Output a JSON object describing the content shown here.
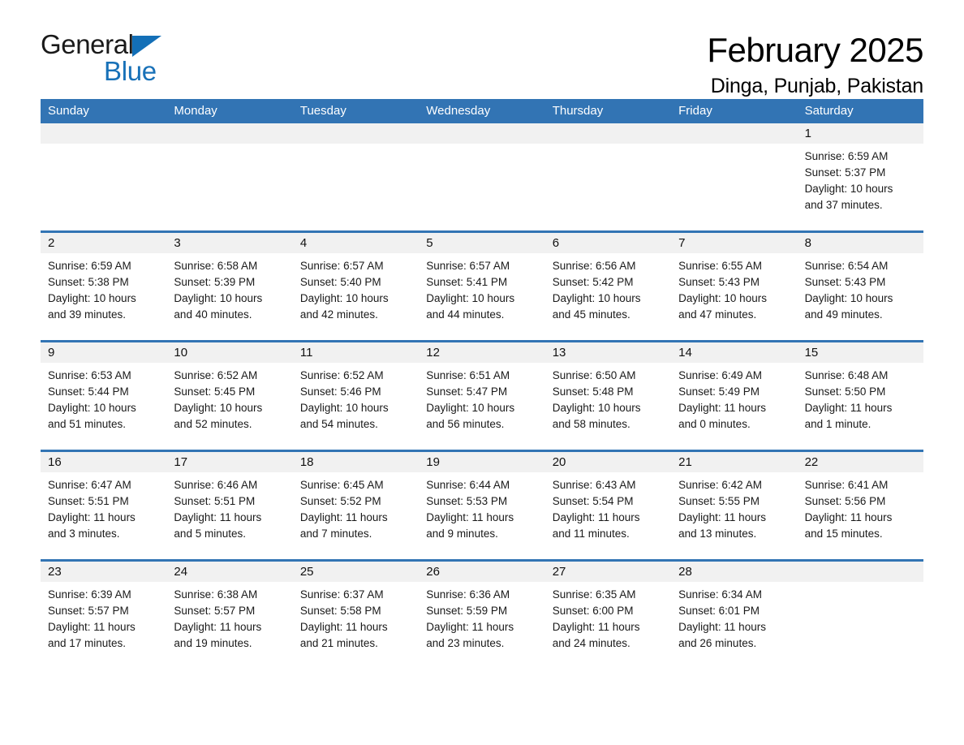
{
  "brand": {
    "name_part1": "General",
    "name_part2": "Blue",
    "accent_color": "#1871b8",
    "triangle_icon": "triangle-icon"
  },
  "header": {
    "month_title": "February 2025",
    "location": "Dinga, Punjab, Pakistan",
    "header_bg_color": "#3274b4",
    "band_bg_color": "#f1f1f1"
  },
  "weekdays": [
    "Sunday",
    "Monday",
    "Tuesday",
    "Wednesday",
    "Thursday",
    "Friday",
    "Saturday"
  ],
  "weeks": [
    [
      {
        "day": "",
        "empty": true
      },
      {
        "day": "",
        "empty": true
      },
      {
        "day": "",
        "empty": true
      },
      {
        "day": "",
        "empty": true
      },
      {
        "day": "",
        "empty": true
      },
      {
        "day": "",
        "empty": true
      },
      {
        "day": "1",
        "sunrise": "Sunrise: 6:59 AM",
        "sunset": "Sunset: 5:37 PM",
        "daylight_line1": "Daylight: 10 hours",
        "daylight_line2": "and 37 minutes."
      }
    ],
    [
      {
        "day": "2",
        "sunrise": "Sunrise: 6:59 AM",
        "sunset": "Sunset: 5:38 PM",
        "daylight_line1": "Daylight: 10 hours",
        "daylight_line2": "and 39 minutes."
      },
      {
        "day": "3",
        "sunrise": "Sunrise: 6:58 AM",
        "sunset": "Sunset: 5:39 PM",
        "daylight_line1": "Daylight: 10 hours",
        "daylight_line2": "and 40 minutes."
      },
      {
        "day": "4",
        "sunrise": "Sunrise: 6:57 AM",
        "sunset": "Sunset: 5:40 PM",
        "daylight_line1": "Daylight: 10 hours",
        "daylight_line2": "and 42 minutes."
      },
      {
        "day": "5",
        "sunrise": "Sunrise: 6:57 AM",
        "sunset": "Sunset: 5:41 PM",
        "daylight_line1": "Daylight: 10 hours",
        "daylight_line2": "and 44 minutes."
      },
      {
        "day": "6",
        "sunrise": "Sunrise: 6:56 AM",
        "sunset": "Sunset: 5:42 PM",
        "daylight_line1": "Daylight: 10 hours",
        "daylight_line2": "and 45 minutes."
      },
      {
        "day": "7",
        "sunrise": "Sunrise: 6:55 AM",
        "sunset": "Sunset: 5:43 PM",
        "daylight_line1": "Daylight: 10 hours",
        "daylight_line2": "and 47 minutes."
      },
      {
        "day": "8",
        "sunrise": "Sunrise: 6:54 AM",
        "sunset": "Sunset: 5:43 PM",
        "daylight_line1": "Daylight: 10 hours",
        "daylight_line2": "and 49 minutes."
      }
    ],
    [
      {
        "day": "9",
        "sunrise": "Sunrise: 6:53 AM",
        "sunset": "Sunset: 5:44 PM",
        "daylight_line1": "Daylight: 10 hours",
        "daylight_line2": "and 51 minutes."
      },
      {
        "day": "10",
        "sunrise": "Sunrise: 6:52 AM",
        "sunset": "Sunset: 5:45 PM",
        "daylight_line1": "Daylight: 10 hours",
        "daylight_line2": "and 52 minutes."
      },
      {
        "day": "11",
        "sunrise": "Sunrise: 6:52 AM",
        "sunset": "Sunset: 5:46 PM",
        "daylight_line1": "Daylight: 10 hours",
        "daylight_line2": "and 54 minutes."
      },
      {
        "day": "12",
        "sunrise": "Sunrise: 6:51 AM",
        "sunset": "Sunset: 5:47 PM",
        "daylight_line1": "Daylight: 10 hours",
        "daylight_line2": "and 56 minutes."
      },
      {
        "day": "13",
        "sunrise": "Sunrise: 6:50 AM",
        "sunset": "Sunset: 5:48 PM",
        "daylight_line1": "Daylight: 10 hours",
        "daylight_line2": "and 58 minutes."
      },
      {
        "day": "14",
        "sunrise": "Sunrise: 6:49 AM",
        "sunset": "Sunset: 5:49 PM",
        "daylight_line1": "Daylight: 11 hours",
        "daylight_line2": "and 0 minutes."
      },
      {
        "day": "15",
        "sunrise": "Sunrise: 6:48 AM",
        "sunset": "Sunset: 5:50 PM",
        "daylight_line1": "Daylight: 11 hours",
        "daylight_line2": "and 1 minute."
      }
    ],
    [
      {
        "day": "16",
        "sunrise": "Sunrise: 6:47 AM",
        "sunset": "Sunset: 5:51 PM",
        "daylight_line1": "Daylight: 11 hours",
        "daylight_line2": "and 3 minutes."
      },
      {
        "day": "17",
        "sunrise": "Sunrise: 6:46 AM",
        "sunset": "Sunset: 5:51 PM",
        "daylight_line1": "Daylight: 11 hours",
        "daylight_line2": "and 5 minutes."
      },
      {
        "day": "18",
        "sunrise": "Sunrise: 6:45 AM",
        "sunset": "Sunset: 5:52 PM",
        "daylight_line1": "Daylight: 11 hours",
        "daylight_line2": "and 7 minutes."
      },
      {
        "day": "19",
        "sunrise": "Sunrise: 6:44 AM",
        "sunset": "Sunset: 5:53 PM",
        "daylight_line1": "Daylight: 11 hours",
        "daylight_line2": "and 9 minutes."
      },
      {
        "day": "20",
        "sunrise": "Sunrise: 6:43 AM",
        "sunset": "Sunset: 5:54 PM",
        "daylight_line1": "Daylight: 11 hours",
        "daylight_line2": "and 11 minutes."
      },
      {
        "day": "21",
        "sunrise": "Sunrise: 6:42 AM",
        "sunset": "Sunset: 5:55 PM",
        "daylight_line1": "Daylight: 11 hours",
        "daylight_line2": "and 13 minutes."
      },
      {
        "day": "22",
        "sunrise": "Sunrise: 6:41 AM",
        "sunset": "Sunset: 5:56 PM",
        "daylight_line1": "Daylight: 11 hours",
        "daylight_line2": "and 15 minutes."
      }
    ],
    [
      {
        "day": "23",
        "sunrise": "Sunrise: 6:39 AM",
        "sunset": "Sunset: 5:57 PM",
        "daylight_line1": "Daylight: 11 hours",
        "daylight_line2": "and 17 minutes."
      },
      {
        "day": "24",
        "sunrise": "Sunrise: 6:38 AM",
        "sunset": "Sunset: 5:57 PM",
        "daylight_line1": "Daylight: 11 hours",
        "daylight_line2": "and 19 minutes."
      },
      {
        "day": "25",
        "sunrise": "Sunrise: 6:37 AM",
        "sunset": "Sunset: 5:58 PM",
        "daylight_line1": "Daylight: 11 hours",
        "daylight_line2": "and 21 minutes."
      },
      {
        "day": "26",
        "sunrise": "Sunrise: 6:36 AM",
        "sunset": "Sunset: 5:59 PM",
        "daylight_line1": "Daylight: 11 hours",
        "daylight_line2": "and 23 minutes."
      },
      {
        "day": "27",
        "sunrise": "Sunrise: 6:35 AM",
        "sunset": "Sunset: 6:00 PM",
        "daylight_line1": "Daylight: 11 hours",
        "daylight_line2": "and 24 minutes."
      },
      {
        "day": "28",
        "sunrise": "Sunrise: 6:34 AM",
        "sunset": "Sunset: 6:01 PM",
        "daylight_line1": "Daylight: 11 hours",
        "daylight_line2": "and 26 minutes."
      },
      {
        "day": "",
        "empty": true
      }
    ]
  ]
}
